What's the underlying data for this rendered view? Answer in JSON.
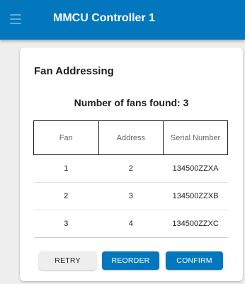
{
  "appbar": {
    "title": "MMCU Controller 1",
    "menu_icon": "hamburger-menu-icon",
    "color": "#0277bd"
  },
  "card": {
    "title": "Fan Addressing",
    "fan_count_text": "Number of fans found: 3"
  },
  "table": {
    "headers": [
      "Fan",
      "Address",
      "Serial Number"
    ],
    "rows": [
      [
        "1",
        "2",
        "134500ZZXA"
      ],
      [
        "2",
        "3",
        "134500ZZXB"
      ],
      [
        "3",
        "4",
        "134500ZZXC"
      ]
    ]
  },
  "actions": {
    "retry_label": "RETRY",
    "reorder_label": "REORDER",
    "confirm_label": "CONFIRM"
  }
}
